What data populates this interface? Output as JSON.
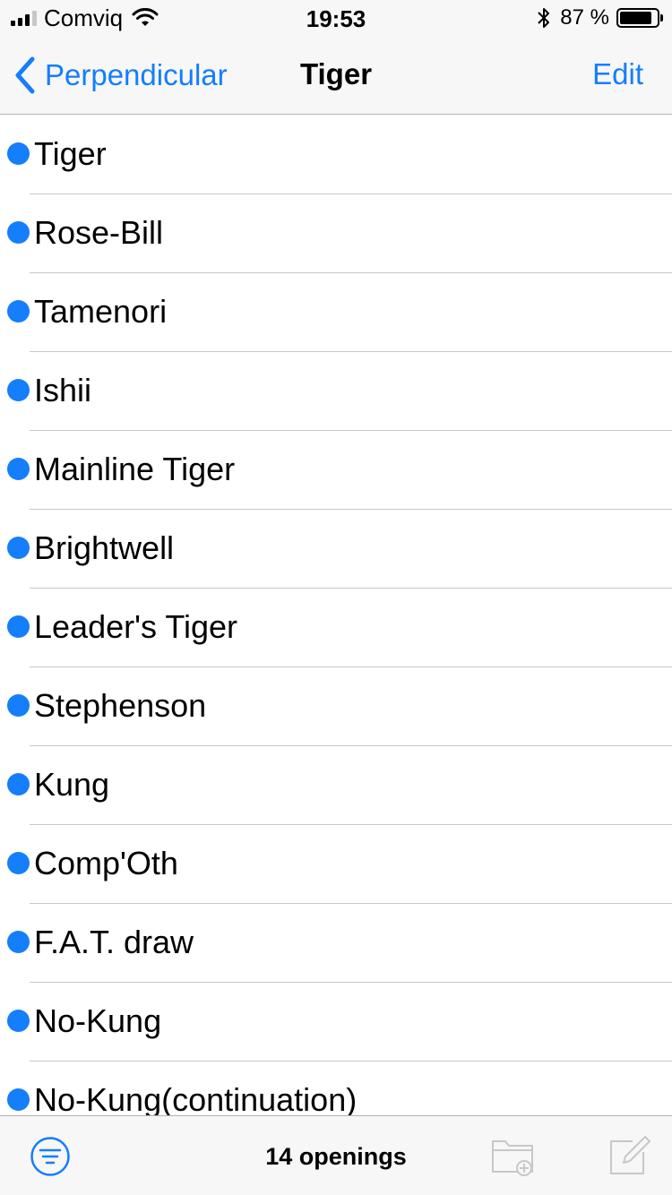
{
  "status_bar": {
    "carrier": "Comviq",
    "time": "19:53",
    "battery": "87 %",
    "battery_level": 0.87
  },
  "nav": {
    "back_label": "Perpendicular",
    "title": "Tiger",
    "edit_label": "Edit"
  },
  "items": [
    "Tiger",
    "Rose-Bill",
    "Tamenori",
    "Ishii",
    "Mainline Tiger",
    "Brightwell",
    "Leader's Tiger",
    "Stephenson",
    "Kung",
    "Comp'Oth",
    "F.A.T. draw",
    "No-Kung",
    "No-Kung(continuation)"
  ],
  "toolbar": {
    "count_label": "14 openings"
  },
  "colors": {
    "accent": "#147efb",
    "bar_background": "#f7f7f7",
    "separator": "#c8c7cc",
    "disabled": "#c7c7cc"
  }
}
